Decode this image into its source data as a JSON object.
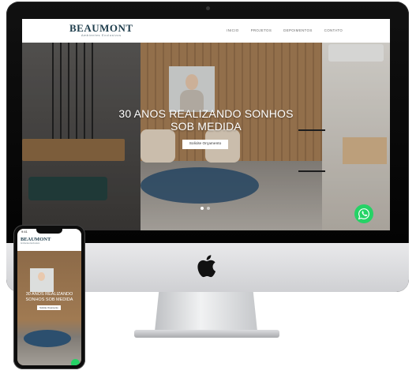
{
  "desktop": {
    "brand": {
      "name": "BEAUMONT",
      "tagline": "Ambientes Exclusivos"
    },
    "nav": [
      {
        "label": "INICIO"
      },
      {
        "label": "PROJETOS"
      },
      {
        "label": "DEPOIMENTOS"
      },
      {
        "label": "CONTATO"
      }
    ],
    "hero": {
      "title": "30 ANOS REALIZANDO SONHOS SOB MEDIDA",
      "cta_label": "Solicite Orçamento"
    },
    "slider_dots": 2,
    "whatsapp_icon": "whatsapp-icon"
  },
  "phone": {
    "status_time": "9:41",
    "brand": {
      "name": "BEAUMONT",
      "tagline": "Ambientes Exclusivos"
    },
    "hero": {
      "title": "30 ANOS REALIZANDO SONHOS SOB MEDIDA",
      "cta_label": "Solicite Orçamento"
    },
    "whatsapp_icon": "whatsapp-icon"
  },
  "colors": {
    "brand_text": "#1e3d4c",
    "whatsapp": "#25d366",
    "wood": "#a07a52",
    "rug": "#2c4f6e"
  }
}
